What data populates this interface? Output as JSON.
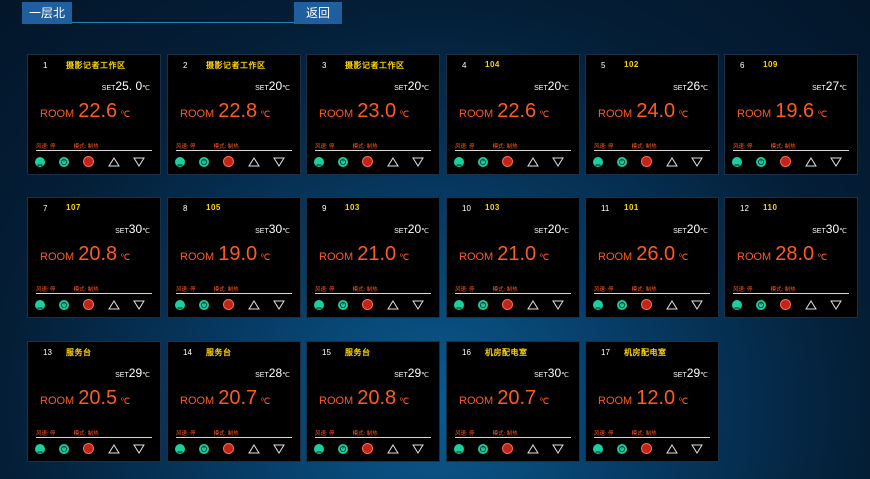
{
  "header": {
    "floor_label": "一层北",
    "search_value": "",
    "back_label": "返回"
  },
  "common": {
    "set_label": "SET",
    "unit": "℃",
    "room_label": "ROOM",
    "fan_text": "风速: 停",
    "mode_text": "模式: 制热"
  },
  "icons": [
    "minus-icon",
    "power-icon",
    "onoff-icon",
    "arrow-up-icon",
    "arrow-down-icon"
  ],
  "colors": {
    "accent": "#1f5f9e",
    "room_name": "#ffd400",
    "temperature": "#ff5a1e",
    "control_green": "#1ad0a0",
    "control_red": "#c0251a"
  },
  "panels": [
    {
      "index": "1",
      "room": "摄影记者工作区",
      "set": "25. 0",
      "temp": "22.6"
    },
    {
      "index": "2",
      "room": "摄影记者工作区",
      "set": "20",
      "temp": "22.8"
    },
    {
      "index": "3",
      "room": "摄影记者工作区",
      "set": "20",
      "temp": "23.0"
    },
    {
      "index": "4",
      "room": "104",
      "set": "20",
      "temp": "22.6"
    },
    {
      "index": "5",
      "room": "102",
      "set": "26",
      "temp": "24.0"
    },
    {
      "index": "6",
      "room": "109",
      "set": "27",
      "temp": "19.6"
    },
    {
      "index": "7",
      "room": "107",
      "set": "30",
      "temp": "20.8"
    },
    {
      "index": "8",
      "room": "105",
      "set": "30",
      "temp": "19.0"
    },
    {
      "index": "9",
      "room": "103",
      "set": "20",
      "temp": "21.0"
    },
    {
      "index": "10",
      "room": "103",
      "set": "20",
      "temp": "21.0"
    },
    {
      "index": "11",
      "room": "101",
      "set": "20",
      "temp": "26.0"
    },
    {
      "index": "12",
      "room": "110",
      "set": "30",
      "temp": "28.0"
    },
    {
      "index": "13",
      "room": "服务台",
      "set": "29",
      "temp": "20.5"
    },
    {
      "index": "14",
      "room": "服务台",
      "set": "28",
      "temp": "20.7"
    },
    {
      "index": "15",
      "room": "服务台",
      "set": "29",
      "temp": "20.8"
    },
    {
      "index": "16",
      "room": "机房配电室",
      "set": "30",
      "temp": "20.7"
    },
    {
      "index": "17",
      "room": "机房配电室",
      "set": "29",
      "temp": "12.0"
    }
  ]
}
